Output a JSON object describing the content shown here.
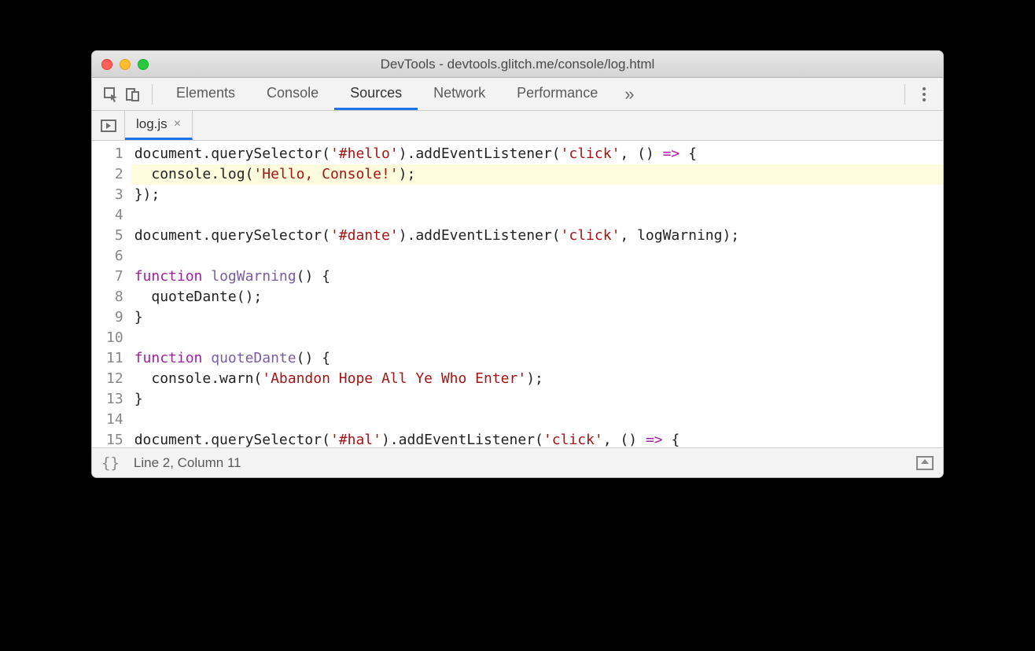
{
  "window": {
    "title": "DevTools - devtools.glitch.me/console/log.html"
  },
  "mainTabs": {
    "items": [
      "Elements",
      "Console",
      "Sources",
      "Network",
      "Performance"
    ],
    "activeIndex": 2,
    "overflowGlyph": "»"
  },
  "fileTab": {
    "name": "log.js",
    "closeGlyph": "×"
  },
  "statusBar": {
    "braces": "{}",
    "position": "Line 2, Column 11"
  },
  "source": {
    "highlightedLine": 2,
    "lines": [
      {
        "n": 1,
        "tokens": [
          {
            "t": "document.querySelector("
          },
          {
            "t": "'#hello'",
            "c": "k-str"
          },
          {
            "t": ").addEventListener("
          },
          {
            "t": "'click'",
            "c": "k-str"
          },
          {
            "t": ", () "
          },
          {
            "t": "=>",
            "c": "k-op"
          },
          {
            "t": " {"
          }
        ]
      },
      {
        "n": 2,
        "tokens": [
          {
            "t": "  console.log("
          },
          {
            "t": "'Hello, Console!'",
            "c": "k-str"
          },
          {
            "t": ");"
          }
        ]
      },
      {
        "n": 3,
        "tokens": [
          {
            "t": "});"
          }
        ]
      },
      {
        "n": 4,
        "tokens": [
          {
            "t": ""
          }
        ]
      },
      {
        "n": 5,
        "tokens": [
          {
            "t": "document.querySelector("
          },
          {
            "t": "'#dante'",
            "c": "k-str"
          },
          {
            "t": ").addEventListener("
          },
          {
            "t": "'click'",
            "c": "k-str"
          },
          {
            "t": ", logWarning);"
          }
        ]
      },
      {
        "n": 6,
        "tokens": [
          {
            "t": ""
          }
        ]
      },
      {
        "n": 7,
        "tokens": [
          {
            "t": "function ",
            "c": "k-kw"
          },
          {
            "t": "logWarning",
            "c": "k-fn"
          },
          {
            "t": "() {"
          }
        ]
      },
      {
        "n": 8,
        "tokens": [
          {
            "t": "  quoteDante();"
          }
        ]
      },
      {
        "n": 9,
        "tokens": [
          {
            "t": "}"
          }
        ]
      },
      {
        "n": 10,
        "tokens": [
          {
            "t": ""
          }
        ]
      },
      {
        "n": 11,
        "tokens": [
          {
            "t": "function ",
            "c": "k-kw"
          },
          {
            "t": "quoteDante",
            "c": "k-fn"
          },
          {
            "t": "() {"
          }
        ]
      },
      {
        "n": 12,
        "tokens": [
          {
            "t": "  console.warn("
          },
          {
            "t": "'Abandon Hope All Ye Who Enter'",
            "c": "k-str"
          },
          {
            "t": ");"
          }
        ]
      },
      {
        "n": 13,
        "tokens": [
          {
            "t": "}"
          }
        ]
      },
      {
        "n": 14,
        "tokens": [
          {
            "t": ""
          }
        ]
      },
      {
        "n": 15,
        "tokens": [
          {
            "t": "document.querySelector("
          },
          {
            "t": "'#hal'",
            "c": "k-str"
          },
          {
            "t": ").addEventListener("
          },
          {
            "t": "'click'",
            "c": "k-str"
          },
          {
            "t": ", () "
          },
          {
            "t": "=>",
            "c": "k-op"
          },
          {
            "t": " {"
          }
        ]
      }
    ]
  }
}
